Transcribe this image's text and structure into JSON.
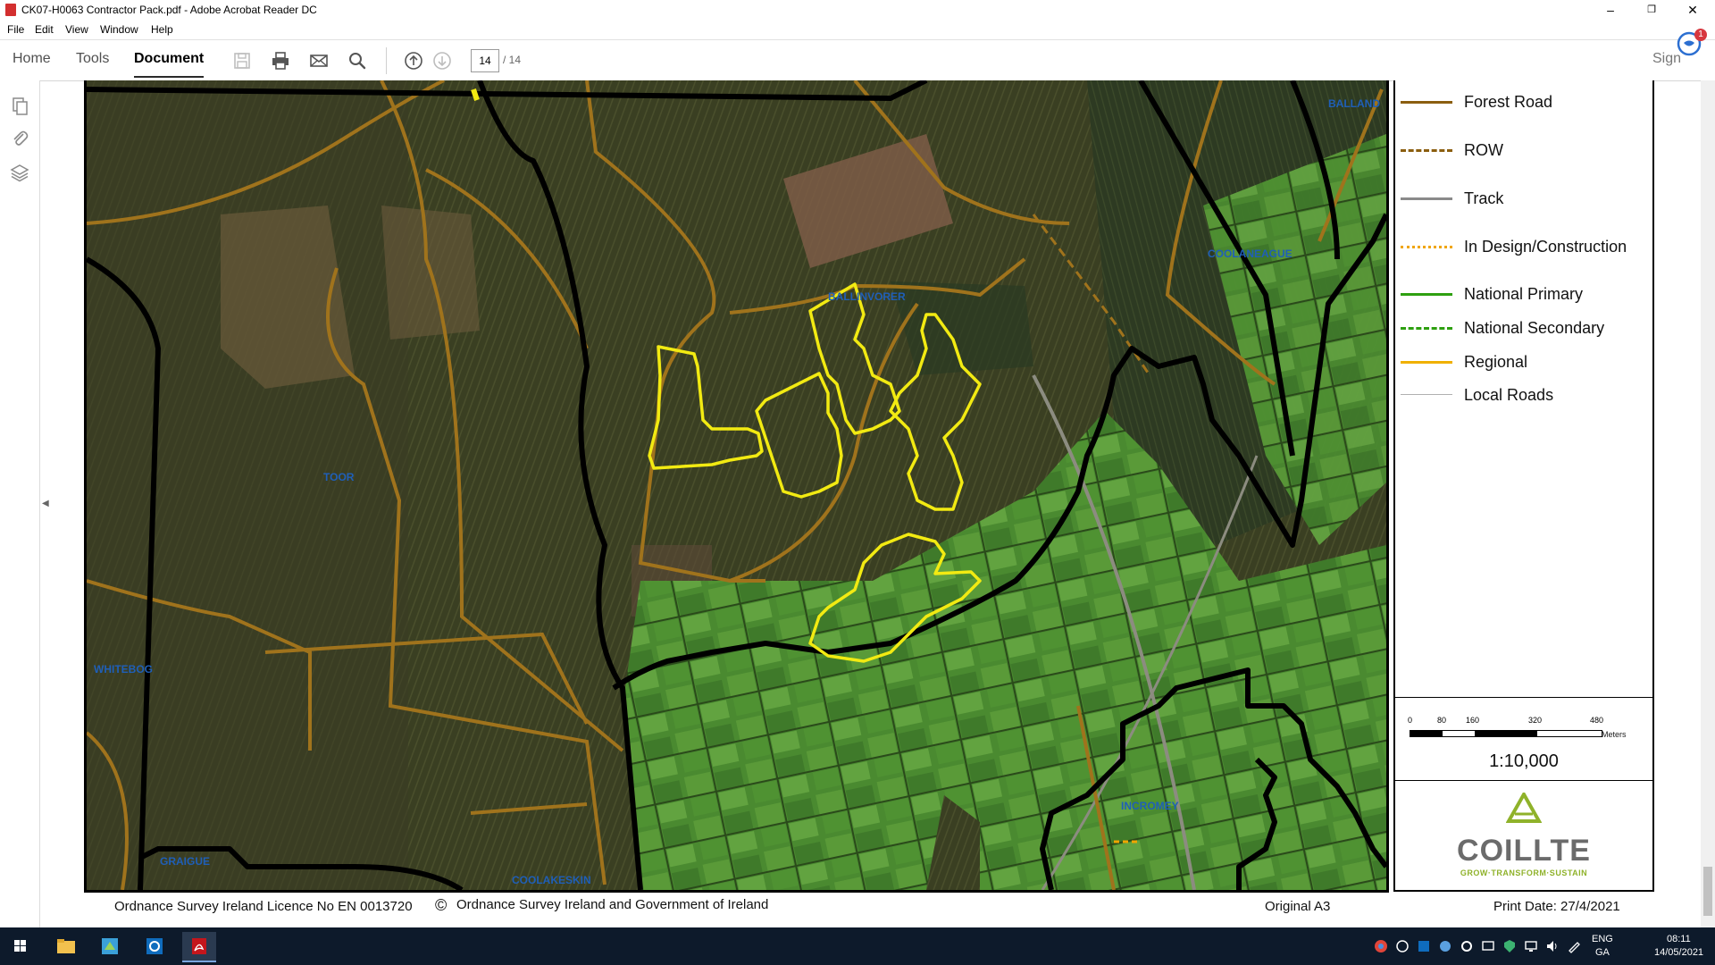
{
  "window": {
    "title": "CK07-H0063 Contractor Pack.pdf - Adobe Acrobat Reader DC",
    "minimize": "–",
    "restore": "❐",
    "close": "✕"
  },
  "menu": [
    "File",
    "Edit",
    "View",
    "Window",
    "Help"
  ],
  "toolbar": {
    "tabs": [
      "Home",
      "Tools",
      "Document"
    ],
    "active_tab": "Document",
    "page_current": "14",
    "page_total": "/ 14",
    "sign_label": "Sign",
    "notification_count": "1",
    "icons": [
      "save-icon",
      "print-icon",
      "email-icon",
      "search-icon",
      "previous-page-icon",
      "next-page-icon"
    ]
  },
  "left_panel": {
    "icons": [
      "page-thumbnails-icon",
      "attachments-icon",
      "layers-icon"
    ]
  },
  "map": {
    "place_labels": [
      "BALLINVORER",
      "COOLANEAGUE",
      "BALLAND",
      "TOOR",
      "WHITEBOG",
      "GRAIGUE",
      "COOLAKESKIN",
      "INCROMEY"
    ],
    "colors": {
      "forest_road": "#a0731c",
      "stand_boundary": "#f2ea12",
      "property_boundary": "#000000"
    }
  },
  "legend": {
    "items": [
      {
        "label": "Forest Road",
        "color": "#8b5e0f",
        "style": "solid"
      },
      {
        "label": "ROW",
        "color": "#8b5e0f",
        "style": "dashed"
      },
      {
        "label": "Track",
        "color": "#8a8a8a",
        "style": "solid"
      },
      {
        "label": "In Design/Construction",
        "color": "#f0a500",
        "style": "dashdot"
      },
      {
        "label": "National Primary",
        "color": "#2ea010",
        "style": "solid"
      },
      {
        "label": "National Secondary",
        "color": "#2ea010",
        "style": "dashed"
      },
      {
        "label": "Regional",
        "color": "#f0b000",
        "style": "solid"
      },
      {
        "label": "Local Roads",
        "color": "#b0b0b0",
        "style": "thin"
      }
    ],
    "scale_ticks": [
      "0",
      "80",
      "160",
      "320",
      "480"
    ],
    "scale_unit": "Meters",
    "scale_ratio": "1:10,000",
    "logo_name": "COILLTE",
    "logo_tagline": "GROW·TRANSFORM·SUSTAIN"
  },
  "footer": {
    "licence": "Ordnance Survey Ireland Licence No EN 0013720",
    "copyright": "Ordnance Survey Ireland and Government of Ireland",
    "copyright_symbol": "©",
    "paper": "Original A3",
    "print_date": "Print Date:  27/4/2021"
  },
  "taskbar": {
    "language_top": "ENG",
    "language_bottom": "GA",
    "time": "08:11",
    "date": "14/05/2021"
  }
}
